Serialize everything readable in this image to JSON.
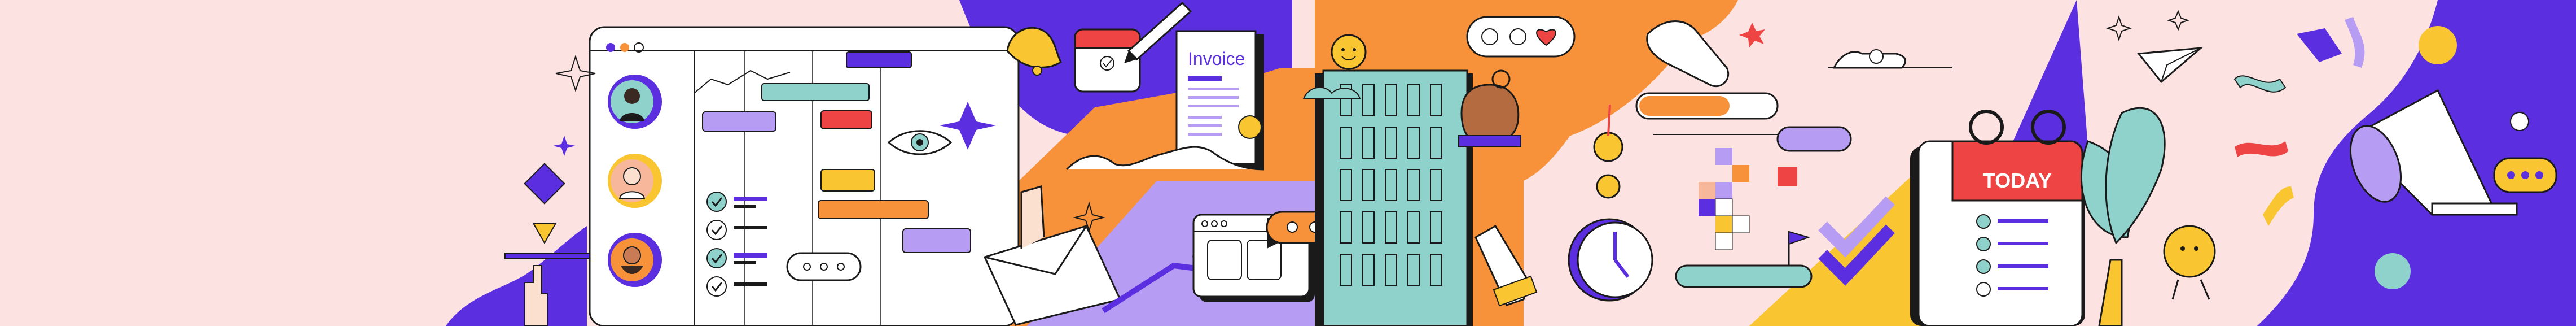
{
  "palette": {
    "pink": "#fde2e2",
    "purple": "#5b2fe0",
    "lavender": "#b69cf3",
    "orange": "#f7923a",
    "yellow": "#f9c531",
    "teal": "#8fd1cb",
    "red": "#ee4444",
    "ink": "#1a1a1a",
    "white": "#ffffff"
  },
  "invoice": {
    "title": "Invoice"
  },
  "calendar": {
    "label": "TODAY"
  },
  "icons": [
    "gantt-app-window",
    "avatar",
    "checkbox-icon",
    "eye-icon",
    "sparkle-icon",
    "bell-icon",
    "calendar-icon",
    "pencil-icon",
    "invoice-document",
    "coin-icon",
    "envelope-icon",
    "chat-bubble-icon",
    "office-building",
    "smiley-icon",
    "heart-icon",
    "clapping-hands-icon",
    "clock-icon",
    "checkmark-icon",
    "flag-icon",
    "paper-plane-icon",
    "plant-icon",
    "megaphone-icon",
    "pointing-hand-icon"
  ]
}
